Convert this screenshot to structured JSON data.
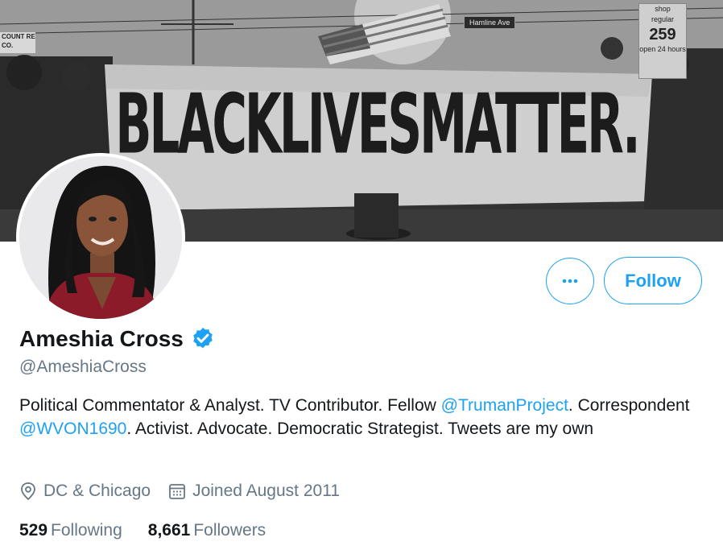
{
  "banner": {
    "banner_text": "BLACKLIVESMATTER.",
    "street_sign": "Hamline Ave",
    "store_sign": "COUNT RE CO.",
    "gas_sign_top": "shop",
    "gas_sign_mid": "regular",
    "gas_sign_price": "259",
    "gas_sign_bottom": "open 24 hours"
  },
  "actions": {
    "more_label": "•••",
    "follow_label": "Follow"
  },
  "profile": {
    "name": "Ameshia Cross",
    "handle": "@AmeshiaCross",
    "verified": true,
    "bio": {
      "part1": "Political Commentator & Analyst. TV Contributor. Fellow ",
      "mention1": "@TrumanProject",
      "part2": ". Correspondent ",
      "mention2": "@WVON1690",
      "part3": ". Activist. Advocate. Democratic Strategist. Tweets are my own"
    },
    "location": "DC & Chicago",
    "joined": "Joined August 2011"
  },
  "stats": {
    "following_count": "529",
    "following_label": "Following",
    "followers_count": "8,661",
    "followers_label": "Followers"
  },
  "colors": {
    "accent": "#1da1f2",
    "secondary_text": "#657786",
    "primary_text": "#14171a"
  },
  "icons": {
    "more": "more-horizontal-icon",
    "verified": "verified-badge-icon",
    "location": "location-pin-icon",
    "calendar": "calendar-icon"
  }
}
